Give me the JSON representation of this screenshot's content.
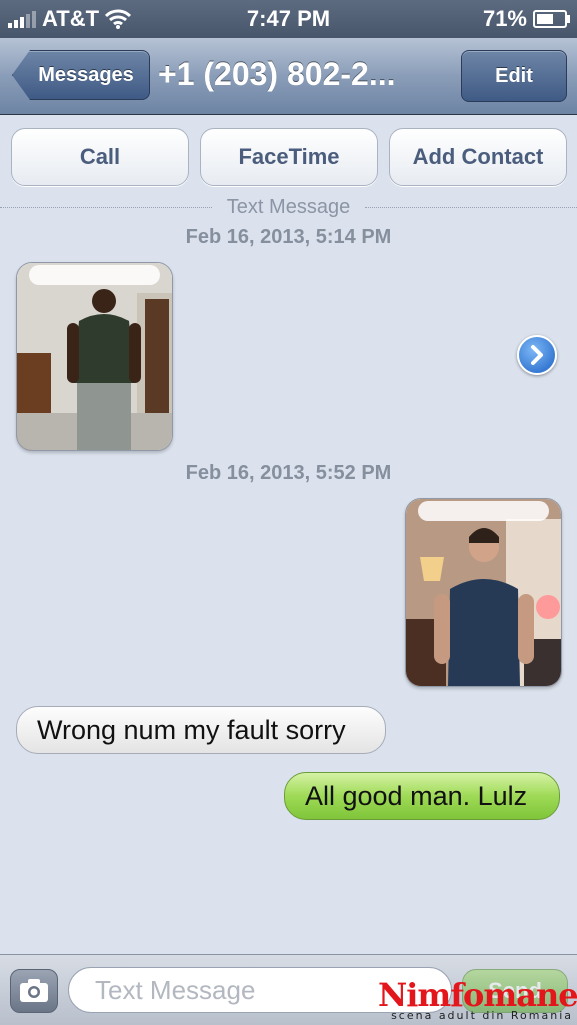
{
  "status_bar": {
    "carrier": "AT&T",
    "time": "7:47 PM",
    "battery_percent_label": "71%",
    "battery_level": 0.71
  },
  "nav": {
    "back_label": "Messages",
    "title": "+1 (203) 802-2...",
    "edit_label": "Edit"
  },
  "actions": {
    "call": "Call",
    "facetime": "FaceTime",
    "add_contact": "Add Contact"
  },
  "thread": {
    "divider_label": "Text Message",
    "timestamp_1": "Feb 16, 2013, 5:14 PM",
    "timestamp_2": "Feb 16, 2013, 5:52 PM",
    "messages": [
      {
        "direction": "incoming",
        "type": "image"
      },
      {
        "direction": "outgoing",
        "type": "image"
      },
      {
        "direction": "incoming",
        "type": "text",
        "text": "Wrong num my fault sorry"
      },
      {
        "direction": "outgoing",
        "type": "text",
        "text": "All good man. Lulz"
      }
    ]
  },
  "composer": {
    "placeholder": "Text Message",
    "send_label": "Send"
  },
  "watermark": {
    "name": "Nimfomane",
    "tagline": "scena adult din Romania"
  },
  "colors": {
    "accent_blue": "#3f5a85",
    "outgoing_green": "#9fda56",
    "background": "#dbe2ed"
  },
  "icons": [
    "signal-icon",
    "wifi-icon",
    "battery-icon",
    "chevron-right-icon",
    "camera-icon"
  ]
}
